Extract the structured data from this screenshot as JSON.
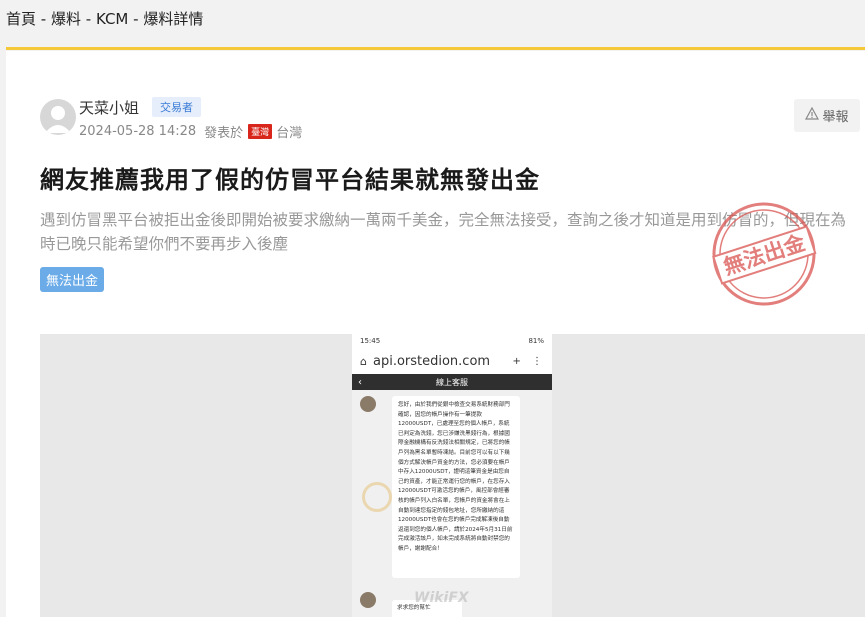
{
  "breadcrumb": {
    "items": [
      "首頁",
      "爆料",
      "KCM",
      "爆料詳情"
    ],
    "separator": " - "
  },
  "author": {
    "name": "天菜小姐",
    "role": "交易者"
  },
  "meta": {
    "date": "2024-05-28 14:28",
    "posted_label": "發表於",
    "flag_label": "臺灣",
    "region": "台灣"
  },
  "report": {
    "label": "舉報",
    "icon": "warning-icon"
  },
  "post": {
    "title": "網友推薦我用了假的仿冒平台結果就無發出金",
    "description": "遇到仿冒黑平台被拒出金後即開始被要求繳納一萬兩千美金，完全無法接受，查詢之後才知道是用到仿冒的，但現在為時已晚只能希望你們不要再步入後塵",
    "tag": "無法出金"
  },
  "stamp": {
    "text": "無法出金"
  },
  "screenshot": {
    "status_time": "15:45",
    "status_right": "81%",
    "url": "api.orstedion.com",
    "chat_title": "線上客服",
    "message": "您好，由於我們從銀中檢查交易系統財務部門確認，因您的帳戶操作有一筆提款12000USDT，已處理至您的個人帳戶，系統已判定為洗錢，您已涉嫌洗黑錢行為，根據國際金融機構有反洗錢法相關規定，已將您的帳戶列為黑名單暫時凍結。目前您可以有以下幾個方式解決帳戶資金的方法，您必須要在帳戶中存入12000USDT，證明這筆資金是由您自己的資產，才能正常運行您的帳戶，在您存入12000USDT可激活您的帳戶，風控部會經審核的帳戶列入白名單，您帳戶的資金將會在上自動到達您指定的錢包地址，您所繳納的這12000USDT也會在您的帳戶完成解凍後自動返還到您的個人帳戶，請於2024年5月31日前完成激活該戶，如未完成系統將自動封禁您的帳戶，謝謝配合！",
    "message2": "求求您的幫忙",
    "watermark": "WikiFX"
  }
}
